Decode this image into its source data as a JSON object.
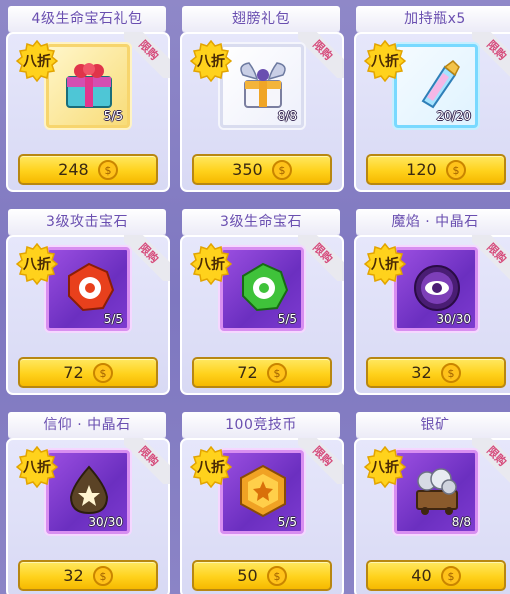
{
  "badge_text": "八折",
  "ribbon_text": "限购",
  "items": [
    {
      "title": "4级生命宝石礼包",
      "count": "5/5",
      "price": "248",
      "icon": "gift-box-icon",
      "frame": "gold"
    },
    {
      "title": "翅膀礼包",
      "count": "8/8",
      "price": "350",
      "icon": "winged-gift-box-icon",
      "frame": "white"
    },
    {
      "title": "加持瓶x5",
      "count": "20/20",
      "price": "120",
      "icon": "enchant-bottle-icon",
      "frame": "cyan"
    },
    {
      "title": "3级攻击宝石",
      "count": "5/5",
      "price": "72",
      "icon": "red-attack-gem-icon",
      "frame": "purple"
    },
    {
      "title": "3级生命宝石",
      "count": "5/5",
      "price": "72",
      "icon": "green-life-gem-icon",
      "frame": "purple"
    },
    {
      "title": "魔焰 · 中晶石",
      "count": "30/30",
      "price": "32",
      "icon": "eye-crystal-icon",
      "frame": "purple"
    },
    {
      "title": "信仰 · 中晶石",
      "count": "30/30",
      "price": "32",
      "icon": "faith-crystal-icon",
      "frame": "purple"
    },
    {
      "title": "100竞技币",
      "count": "5/5",
      "price": "50",
      "icon": "arena-coin-icon",
      "frame": "purple"
    },
    {
      "title": "银矿",
      "count": "8/8",
      "price": "40",
      "icon": "silver-ore-cart-icon",
      "frame": "purple"
    }
  ],
  "colors": {
    "background": "#8f88c8",
    "title_text": "#6a4fb0",
    "price_button": "#ffd21c",
    "rare_frame": "#7d3ad0"
  }
}
